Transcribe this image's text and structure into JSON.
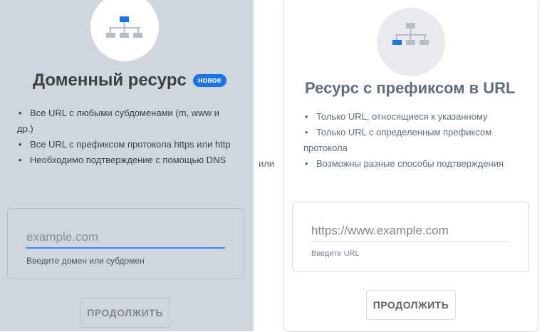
{
  "or_label": "или",
  "domain_resource": {
    "title": "Доменный ресурс",
    "badge": "новое",
    "bullets": [
      "Все URL с любыми субдоменами (m, www и др.)",
      "Все URL с префиксом протокола https или http",
      "Необходимо подтверждение с помощью DNS"
    ],
    "input_placeholder": "example.com",
    "input_helper": "Введите домен или субдомен",
    "continue_label": "ПРОДОЛЖИТЬ",
    "icon": "sitemap-icon",
    "accent_color": "#4285f4"
  },
  "url_prefix_resource": {
    "title": "Ресурс с префиксом в URL",
    "bullets": [
      "Только URL, относящиеся к указанному",
      "Только URL с определенным префиксом протокола",
      "Возможны разные способы подтверждения"
    ],
    "input_placeholder": "https://www.example.com",
    "input_helper": "Введите URL",
    "continue_label": "ПРОДОЛЖИТЬ",
    "icon": "sitemap-icon"
  }
}
